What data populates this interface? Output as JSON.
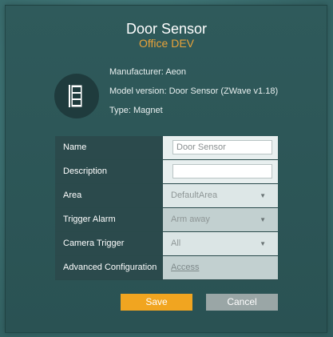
{
  "device": {
    "title": "Door Sensor",
    "subtitle": "Office DEV",
    "manufacturer": "Manufacturer: Aeon",
    "model_version": "Model version: Door Sensor (ZWave v1.18)",
    "type": "Type: Magnet",
    "icon": "door-sensor-icon"
  },
  "form": {
    "name": {
      "label": "Name",
      "value": "Door Sensor"
    },
    "description": {
      "label": "Description",
      "value": ""
    },
    "area": {
      "label": "Area",
      "value": "DefaultArea"
    },
    "trigger_alarm": {
      "label": "Trigger Alarm",
      "value": "Arm away"
    },
    "camera_trigger": {
      "label": "Camera Trigger",
      "value": "All"
    },
    "advanced": {
      "label": "Advanced Configuration",
      "link": "Access"
    }
  },
  "buttons": {
    "save": "Save",
    "cancel": "Cancel"
  },
  "colors": {
    "accent": "#f1a520",
    "subtitle": "#e8a33a",
    "panel": "#2f5a5b",
    "label_cell": "#2b4a4c",
    "cancel": "#9aa6a6"
  }
}
